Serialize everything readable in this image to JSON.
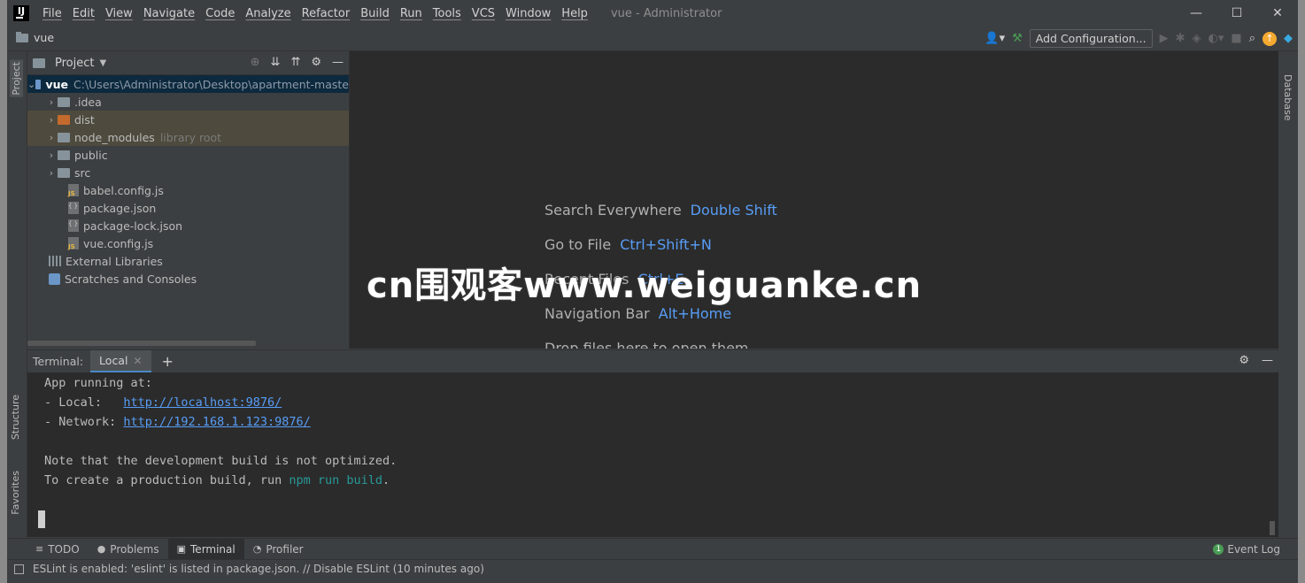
{
  "window": {
    "title": "vue - Administrator",
    "menu": [
      "File",
      "Edit",
      "View",
      "Navigate",
      "Code",
      "Analyze",
      "Refactor",
      "Build",
      "Run",
      "Tools",
      "VCS",
      "Window",
      "Help"
    ],
    "controls": {
      "minimize": "—",
      "maximize": "☐",
      "close": "✕"
    }
  },
  "navbar": {
    "project_name": "vue",
    "add_configuration": "Add Configuration..."
  },
  "stripes": {
    "project": "Project",
    "structure": "Structure",
    "favorites": "Favorites",
    "database": "Database"
  },
  "project_panel": {
    "title": "Project",
    "root": {
      "name": "vue",
      "path": "C:\\Users\\Administrator\\Desktop\\apartment-maste"
    },
    "items": [
      {
        "name": ".idea",
        "type": "folder"
      },
      {
        "name": "dist",
        "type": "folder-excluded"
      },
      {
        "name": "node_modules",
        "type": "folder-excluded",
        "suffix": "library root"
      },
      {
        "name": "public",
        "type": "folder"
      },
      {
        "name": "src",
        "type": "folder"
      },
      {
        "name": "babel.config.js",
        "type": "js"
      },
      {
        "name": "package.json",
        "type": "json"
      },
      {
        "name": "package-lock.json",
        "type": "json"
      },
      {
        "name": "vue.config.js",
        "type": "js"
      },
      {
        "name": "External Libraries",
        "type": "lib"
      },
      {
        "name": "Scratches and Consoles",
        "type": "scratch"
      }
    ]
  },
  "editor": {
    "hints": [
      {
        "label": "Search Everywhere",
        "shortcut": "Double Shift"
      },
      {
        "label": "Go to File",
        "shortcut": "Ctrl+Shift+N"
      },
      {
        "label": "Recent Files",
        "shortcut": "Ctrl+E"
      },
      {
        "label": "Navigation Bar",
        "shortcut": "Alt+Home"
      },
      {
        "label": "Drop files here to open them",
        "shortcut": ""
      }
    ]
  },
  "terminal": {
    "label": "Terminal:",
    "tab": "Local",
    "lines": {
      "l1": "App running at:",
      "l2_prefix": "- Local:   ",
      "l2_link": "http://localhost:9876/",
      "l3_prefix": "- Network: ",
      "l3_link": "http://192.168.1.123:9876/",
      "l4": "Note that the development build is not optimized.",
      "l5_prefix": "To create a production build, run ",
      "l5_cmd": "npm run build",
      "l5_suffix": "."
    }
  },
  "tool_windows": [
    {
      "label": "TODO",
      "icon": "≡"
    },
    {
      "label": "Problems",
      "icon": "●"
    },
    {
      "label": "Terminal",
      "icon": "▣"
    },
    {
      "label": "Profiler",
      "icon": "◔"
    }
  ],
  "event_log": {
    "label": "Event Log",
    "count": "1"
  },
  "status": {
    "message": "ESLint is enabled: 'eslint' is listed in package.json. // Disable ESLint (10 minutes ago)"
  },
  "watermark": "cn围观客www.weiguanke.cn",
  "colors": {
    "accent": "#589df6",
    "selection": "#0d293e",
    "excluded": "#4e4a3d",
    "command": "#299999"
  }
}
